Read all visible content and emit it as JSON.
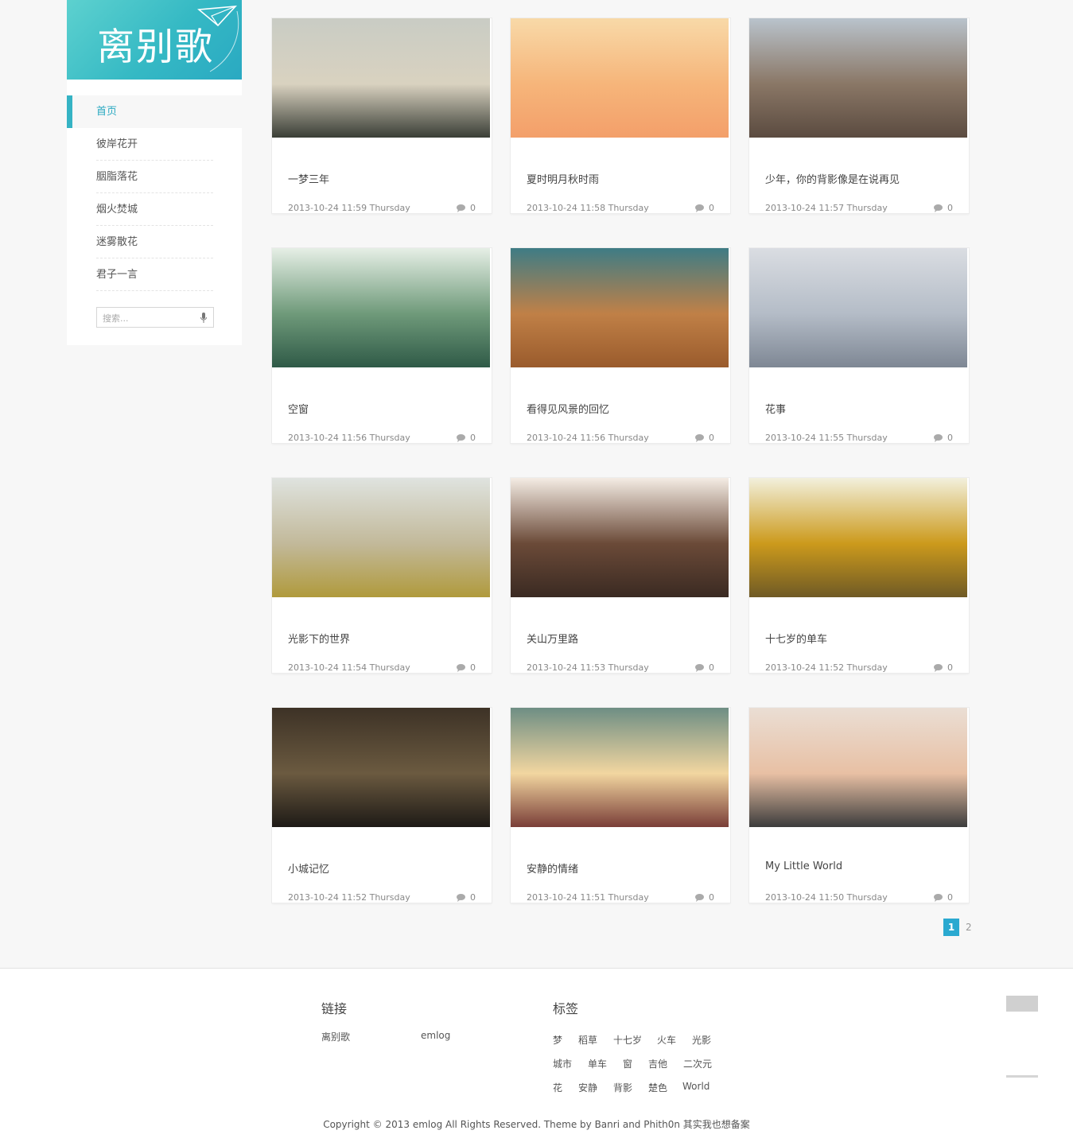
{
  "site": {
    "logo_text": "离别歌",
    "brand_color": "#35b9c4"
  },
  "nav": {
    "items": [
      {
        "label": "首页",
        "active": true
      },
      {
        "label": "彼岸花开"
      },
      {
        "label": "胭脂落花"
      },
      {
        "label": "烟火焚城"
      },
      {
        "label": "迷雾散花"
      },
      {
        "label": "君子一言"
      }
    ]
  },
  "search": {
    "placeholder": "搜索...",
    "icon": "mic-icon"
  },
  "posts": [
    {
      "title": "一梦三年",
      "date": "2013-10-24 11:59 Thursday",
      "comments": "0",
      "colors": [
        "#c9ccc4",
        "#d9d2c0",
        "#3a3e36"
      ]
    },
    {
      "title": "夏时明月秋时雨",
      "date": "2013-10-24 11:58 Thursday",
      "comments": "0",
      "colors": [
        "#f8d9a8",
        "#f6b57a",
        "#f39f6a"
      ]
    },
    {
      "title": "少年，你的背影像是在说再见",
      "date": "2013-10-24 11:57 Thursday",
      "comments": "0",
      "colors": [
        "#b9c3cc",
        "#8a7766",
        "#5b4b40"
      ]
    },
    {
      "title": "空窗",
      "date": "2013-10-24 11:56 Thursday",
      "comments": "0",
      "colors": [
        "#e6efe6",
        "#6f9a7a",
        "#2f5a47"
      ]
    },
    {
      "title": "看得见风景的回忆",
      "date": "2013-10-24 11:56 Thursday",
      "comments": "0",
      "colors": [
        "#3e7c85",
        "#c08047",
        "#9a5b2c"
      ]
    },
    {
      "title": "花事",
      "date": "2013-10-24 11:55 Thursday",
      "comments": "0",
      "colors": [
        "#dadde2",
        "#b4bcc7",
        "#7e8794"
      ]
    },
    {
      "title": "光影下的世界",
      "date": "2013-10-24 11:54 Thursday",
      "comments": "0",
      "colors": [
        "#dfe3df",
        "#c2b99a",
        "#b09a3c"
      ]
    },
    {
      "title": "关山万里路",
      "date": "2013-10-24 11:53 Thursday",
      "comments": "0",
      "colors": [
        "#f4ece4",
        "#6b4a38",
        "#3a2a22"
      ]
    },
    {
      "title": "十七岁的单车",
      "date": "2013-10-24 11:52 Thursday",
      "comments": "0",
      "colors": [
        "#f2f0dc",
        "#cc9a1c",
        "#6f5a25"
      ]
    },
    {
      "title": "小城记忆",
      "date": "2013-10-24 11:52 Thursday",
      "comments": "0",
      "colors": [
        "#3d3226",
        "#6b5a40",
        "#1e1a16"
      ]
    },
    {
      "title": "安静的情绪",
      "date": "2013-10-24 11:51 Thursday",
      "comments": "0",
      "colors": [
        "#6e8e84",
        "#f2d6a0",
        "#7a3e38"
      ]
    },
    {
      "title": "My Little World",
      "date": "2013-10-24 11:50 Thursday",
      "comments": "0",
      "colors": [
        "#eaded4",
        "#e8c0a4",
        "#3c3c3c"
      ]
    }
  ],
  "pagination": {
    "current": "1",
    "next": "2"
  },
  "footer": {
    "links_heading": "链接",
    "links": [
      "离别歌",
      "emlog"
    ],
    "tags_heading": "标签",
    "tags": [
      [
        "梦",
        "稻草",
        "十七岁",
        "火车",
        "光影"
      ],
      [
        "城市",
        "单车",
        "窗",
        "吉他",
        "二次元"
      ],
      [
        "花",
        "安静",
        "背影",
        "楚色",
        "World"
      ]
    ],
    "copyright": "Copyright © 2013 emlog All Rights Reserved. Theme by Banri and Phith0n 其实我也想备案"
  }
}
